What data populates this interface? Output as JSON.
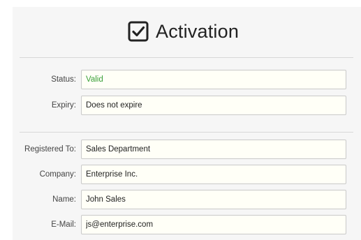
{
  "header": {
    "title": "Activation",
    "icon": "checkbox-checked-icon"
  },
  "fields": {
    "status": {
      "label": "Status:",
      "value": "Valid",
      "value_color": "#3aa038"
    },
    "expiry": {
      "label": "Expiry:",
      "value": "Does not expire"
    },
    "registered_to": {
      "label": "Registered To:",
      "value": "Sales Department"
    },
    "company": {
      "label": "Company:",
      "value": "Enterprise Inc."
    },
    "name": {
      "label": "Name:",
      "value": "John Sales"
    },
    "email": {
      "label": "E-Mail:",
      "value": "js@enterprise.com"
    }
  }
}
